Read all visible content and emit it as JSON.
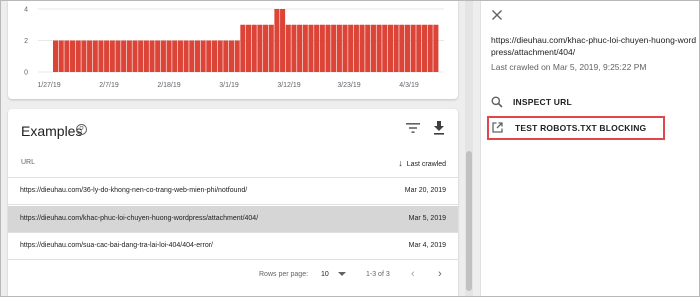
{
  "colors": {
    "bar": "#db4437",
    "highlight": "#e0474c",
    "grid": "#e8e8e8"
  },
  "chart_data": {
    "type": "bar",
    "x_tick_labels": [
      "1/27/19",
      "2/7/19",
      "2/18/19",
      "3/1/19",
      "3/12/19",
      "3/23/19",
      "4/3/19"
    ],
    "y_tick_labels": [
      "4",
      "2",
      "0"
    ],
    "ylim": [
      0,
      4
    ],
    "values": [
      2,
      2,
      2,
      2,
      2,
      2,
      2,
      2,
      2,
      2,
      2,
      2,
      2,
      2,
      2,
      2,
      2,
      2,
      2,
      2,
      2,
      2,
      2,
      2,
      2,
      2,
      2,
      2,
      2,
      2,
      2,
      2,
      2,
      3,
      3,
      3,
      3,
      3,
      3,
      4,
      4,
      3,
      3,
      3,
      3,
      3,
      3,
      3,
      3,
      3,
      3,
      3,
      3,
      3,
      3,
      3,
      3,
      3,
      3,
      3,
      3,
      3,
      3,
      3,
      3,
      3,
      3,
      3
    ],
    "grid": true,
    "title": "",
    "xlabel": "",
    "ylabel": ""
  },
  "examples": {
    "title": "Examples",
    "help_icon_glyph": "?",
    "filter_icon": "filter-icon",
    "download_icon": "download-icon",
    "col_url": "URL",
    "col_last_crawled": "Last crawled",
    "sort_arrow": "↓",
    "rows": [
      {
        "url": "https://dieuhau.com/36-ly-do-khong-nen-co-trang-web-mien-phi/notfound/",
        "date": "Mar 20, 2019"
      },
      {
        "url": "https://dieuhau.com/khac-phuc-loi-chuyen-huong-wordpress/attachment/404/",
        "date": "Mar 5, 2019"
      },
      {
        "url": "https://dieuhau.com/sua-cac-bai-dang-tra-lai-loi-404/404-error/",
        "date": "Mar 4, 2019"
      }
    ],
    "pager": {
      "rows_per_page_label": "Rows per page:",
      "rows_per_page": "10",
      "range": "1-3 of 3",
      "prev": "‹",
      "next": "›"
    }
  },
  "panel": {
    "close_icon": "close-icon",
    "url": "https://dieuhau.com/khac-phuc-loi-chuyen-huong-wordpress/attachment/404/",
    "last_crawled": "Last crawled on Mar 5, 2019, 9:25:22 PM",
    "inspect_label": "INSPECT URL",
    "robots_label": "TEST ROBOTS.TXT BLOCKING"
  }
}
